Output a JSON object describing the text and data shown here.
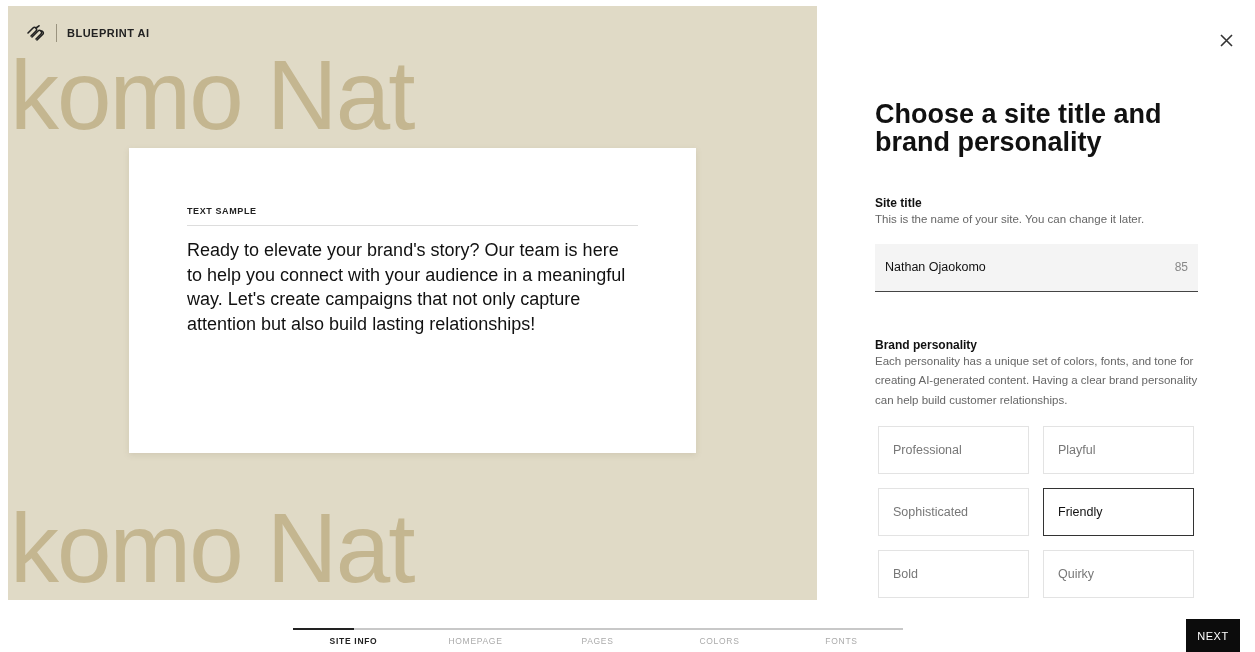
{
  "brand": {
    "name": "BLUEPRINT AI"
  },
  "preview": {
    "backdrop_rows": [
      "komo Nat",
      "komo Nat"
    ],
    "sample_label": "TEXT SAMPLE",
    "sample_text": "Ready to elevate your brand's story? Our team is here to help you connect with your audience in a meaningful way. Let's create campaigns that not only capture attention but also build lasting relationships!"
  },
  "panel": {
    "heading": "Choose a site title and brand personality",
    "site_title": {
      "label": "Site title",
      "hint": "This is the name of your site. You can change it later.",
      "value": "Nathan Ojaokomo",
      "counter": "85"
    },
    "brand_personality": {
      "label": "Brand personality",
      "hint": "Each personality has a unique set of colors, fonts, and tone for creating AI-generated content. Having a clear brand personality can help build customer relationships.",
      "options": [
        {
          "label": "Professional",
          "selected": false
        },
        {
          "label": "Playful",
          "selected": false
        },
        {
          "label": "Sophisticated",
          "selected": false
        },
        {
          "label": "Friendly",
          "selected": true
        },
        {
          "label": "Bold",
          "selected": false
        },
        {
          "label": "Quirky",
          "selected": false
        }
      ]
    }
  },
  "progress": {
    "level": 0.1,
    "steps": [
      {
        "label": "SITE INFO",
        "selected": true
      },
      {
        "label": "HOMEPAGE",
        "selected": false
      },
      {
        "label": "PAGES",
        "selected": false
      },
      {
        "label": "COLORS",
        "selected": false
      },
      {
        "label": "FONTS",
        "selected": false
      }
    ]
  },
  "next_button": "NEXT"
}
